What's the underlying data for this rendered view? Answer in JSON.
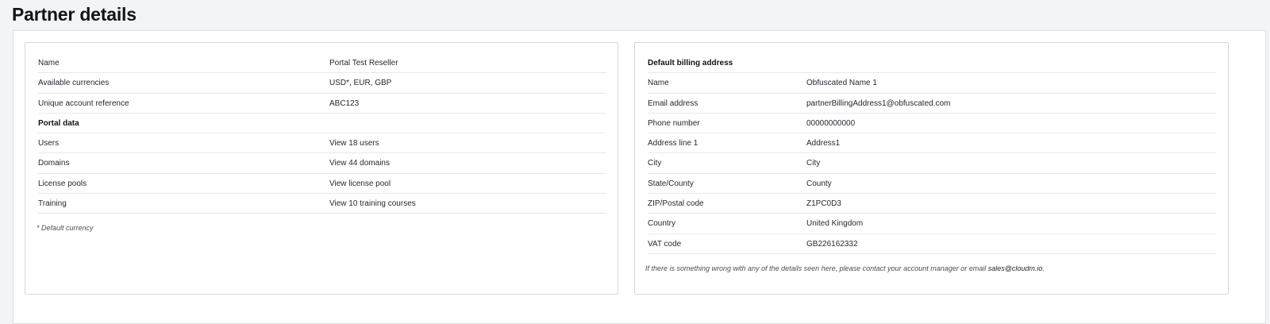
{
  "page": {
    "title": "Partner details"
  },
  "left_panel": {
    "rows": [
      {
        "label": "Name",
        "value": "Portal Test Reseller"
      },
      {
        "label": "Available currencies",
        "value": "USD*, EUR, GBP"
      },
      {
        "label": "Unique account reference",
        "value": "ABC123"
      }
    ],
    "section_heading": "Portal data",
    "portal_rows": [
      {
        "label": "Users",
        "value": "View 18 users"
      },
      {
        "label": "Domains",
        "value": "View 44 domains"
      },
      {
        "label": "License pools",
        "value": "View license pool"
      },
      {
        "label": "Training",
        "value": "View 10 training courses"
      }
    ],
    "footnote": "* Default currency"
  },
  "right_panel": {
    "section_heading": "Default billing address",
    "rows": [
      {
        "label": "Name",
        "value": "Obfuscated Name 1"
      },
      {
        "label": "Email address",
        "value": "partnerBillingAddress1@obfuscated.com"
      },
      {
        "label": "Phone number",
        "value": "00000000000"
      },
      {
        "label": "Address line 1",
        "value": "Address1"
      },
      {
        "label": "City",
        "value": "City"
      },
      {
        "label": "State/County",
        "value": "County"
      },
      {
        "label": "ZIP/Postal code",
        "value": "Z1PC0D3"
      },
      {
        "label": "Country",
        "value": "United Kingdom"
      },
      {
        "label": "VAT code",
        "value": "GB226162332"
      }
    ],
    "contact_note": "If there is something wrong with any of the details seen here, please contact your account manager or email ",
    "contact_email": "sales@cloudm.io",
    "contact_note_end": "."
  }
}
